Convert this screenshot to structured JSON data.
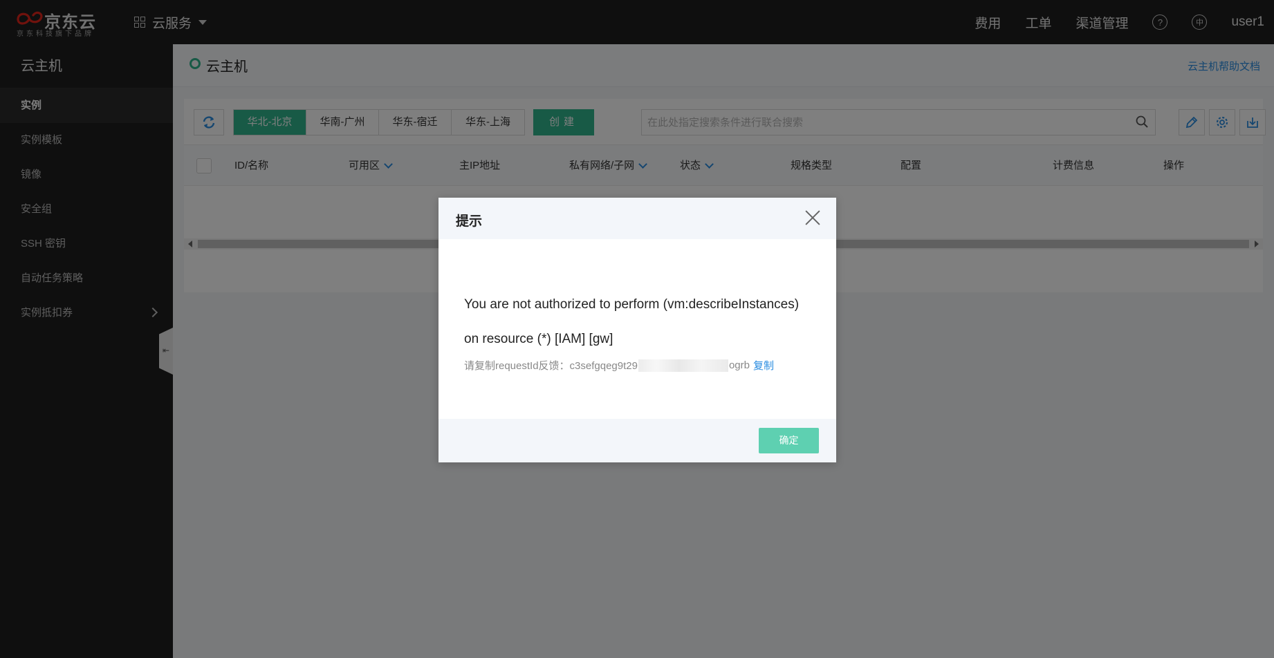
{
  "topbar": {
    "brand": "京东云",
    "brand_sub": "京东科技旗下品牌",
    "services_label": "云服务",
    "nav": [
      "费用",
      "工单",
      "渠道管理"
    ],
    "help_glyph": "?",
    "lang_glyph": "中",
    "user": "user1"
  },
  "sidebar": {
    "title": "云主机",
    "items": [
      {
        "label": "实例",
        "active": true
      },
      {
        "label": "实例模板"
      },
      {
        "label": "镜像"
      },
      {
        "label": "安全组"
      },
      {
        "label": "SSH 密钥"
      },
      {
        "label": "自动任务策略"
      },
      {
        "label": "实例抵扣券",
        "has_children": true
      }
    ],
    "collapse_glyph": "⇤"
  },
  "page": {
    "title": "云主机",
    "help_link": "云主机帮助文档"
  },
  "toolbar": {
    "regions": [
      "华北-北京",
      "华南-广州",
      "华东-宿迁",
      "华东-上海"
    ],
    "active_region": "华北-北京",
    "create_label": "创建",
    "search_placeholder": "在此处指定搜索条件进行联合搜索"
  },
  "table": {
    "columns": [
      "ID/名称",
      "可用区",
      "主IP地址",
      "私有网络/子网",
      "状态",
      "规格类型",
      "配置",
      "计费信息",
      "操作"
    ]
  },
  "dialog": {
    "title": "提示",
    "message_line1": "You are not authorized to perform (vm:describeInstances)",
    "message_line2": "on resource (*) [IAM] [gw]",
    "request_prefix": "请复制requestId反馈：c3sefgqeg9t29",
    "request_suffix": "ogrb",
    "copy_label": "复制",
    "ok_label": "确定"
  },
  "colors": {
    "accent": "#31b48d",
    "link": "#2a8ce0",
    "topbar_bg": "#1f1f1f",
    "brand_red": "#e1251b"
  }
}
